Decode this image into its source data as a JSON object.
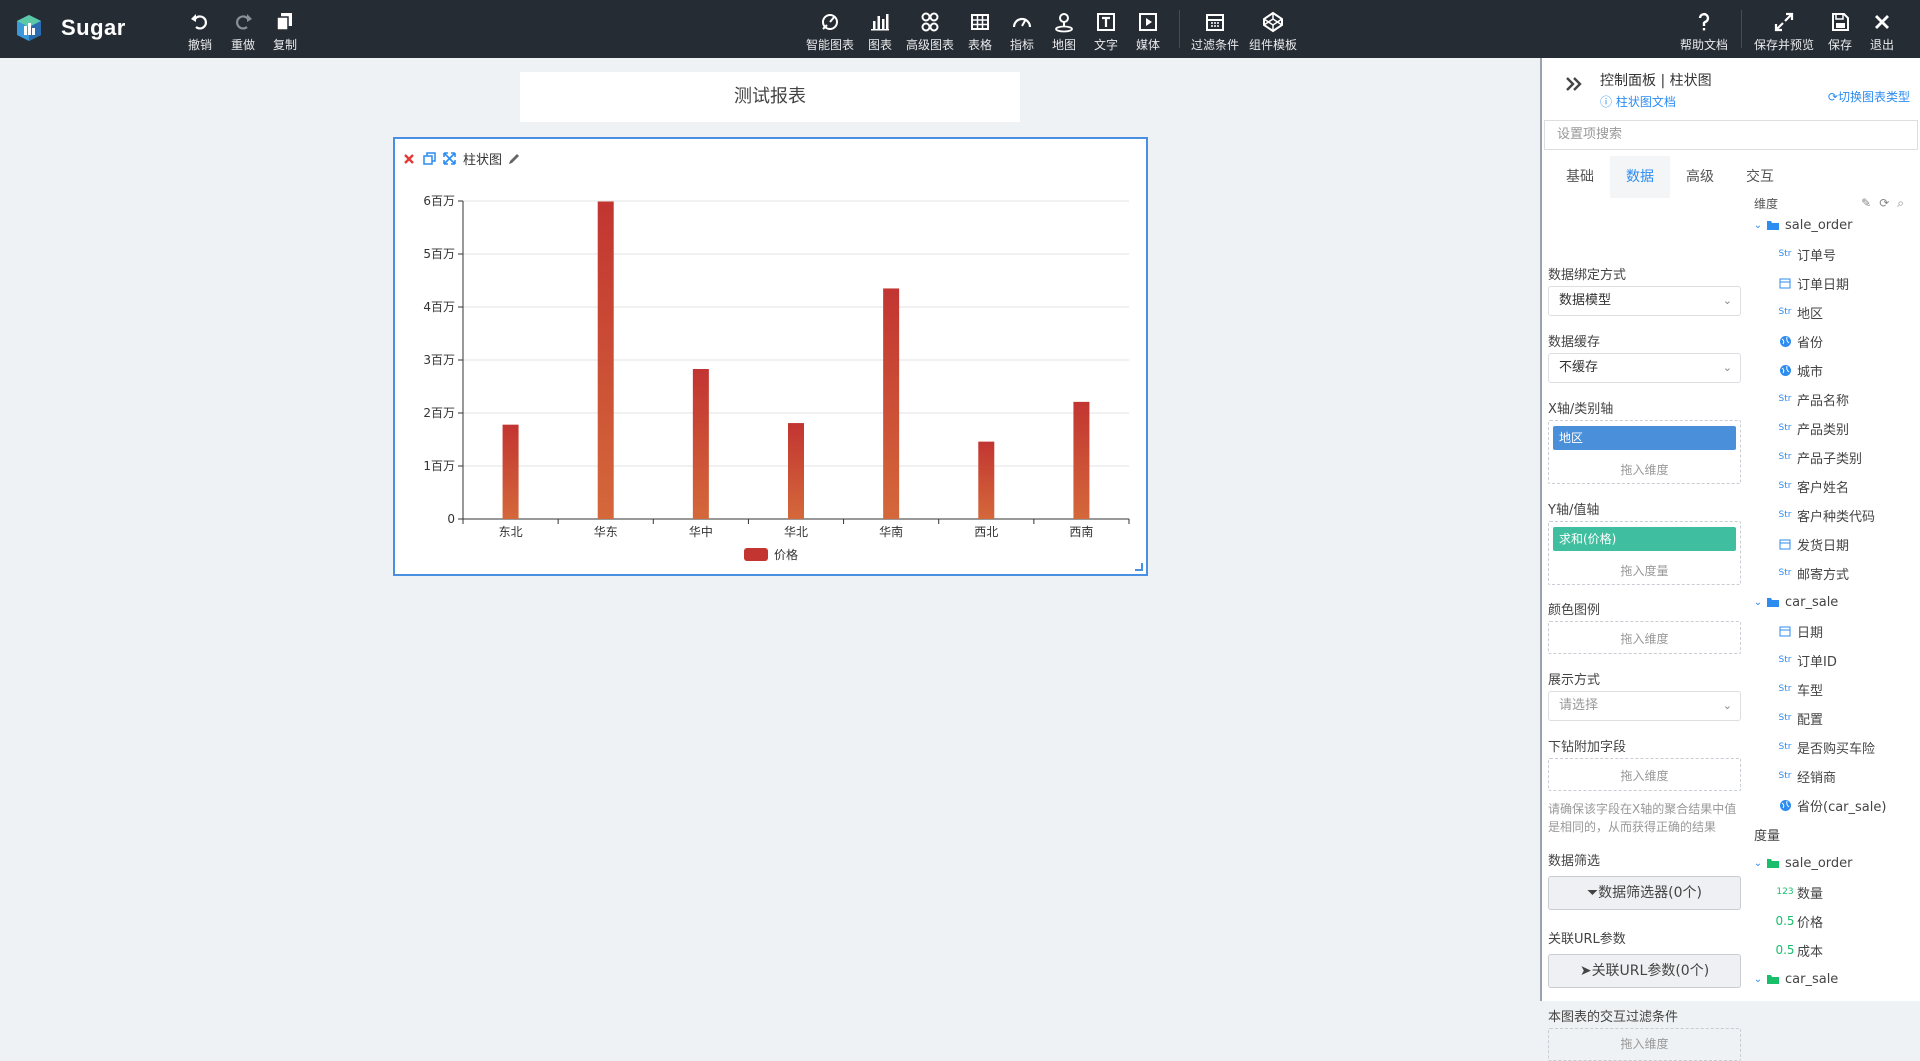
{
  "app": {
    "name": "Sugar"
  },
  "toolbar": {
    "undo": "撤销",
    "redo": "重做",
    "copy": "复制",
    "smart_chart": "智能图表",
    "chart": "图表",
    "advanced_chart": "高级图表",
    "table": "表格",
    "indicator": "指标",
    "map": "地图",
    "text": "文字",
    "media": "媒体",
    "filter": "过滤条件",
    "template": "组件模板",
    "help": "帮助文档",
    "save_preview": "保存并预览",
    "save": "保存",
    "exit": "退出"
  },
  "report": {
    "title": "测试报表"
  },
  "widget": {
    "title": "柱状图"
  },
  "chart_data": {
    "type": "bar",
    "categories": [
      "东北",
      "华东",
      "华中",
      "华北",
      "华南",
      "西北",
      "西南"
    ],
    "series": [
      {
        "name": "价格",
        "values": [
          1780000,
          5990000,
          2830000,
          1810000,
          4350000,
          1460000,
          2210000
        ]
      }
    ],
    "ylim": [
      0,
      6000000
    ],
    "yticks": [
      0,
      1000000,
      2000000,
      3000000,
      4000000,
      5000000,
      6000000
    ],
    "ytick_labels": [
      "0",
      "1百万",
      "2百万",
      "3百万",
      "4百万",
      "5百万",
      "6百万"
    ],
    "grid": true,
    "legend": "bottom-center",
    "colors": {
      "bar_top": "#c23531",
      "bar_bottom": "#d4683a"
    }
  },
  "panel": {
    "title": "控制面板 | 柱状图",
    "doc_link": "柱状图文档",
    "switch_type": "切换图表类型",
    "search_placeholder": "设置项搜索",
    "tabs": [
      "基础",
      "数据",
      "高级",
      "交互"
    ],
    "config": {
      "binding_label": "数据绑定方式",
      "binding_value": "数据模型",
      "cache_label": "数据缓存",
      "cache_value": "不缓存",
      "x_label": "X轴/类别轴",
      "x_chip": "地区",
      "x_hint": "拖入维度",
      "y_label": "Y轴/值轴",
      "y_chip": "求和(价格)",
      "y_hint": "拖入度量",
      "legend_label": "颜色图例",
      "legend_hint": "拖入维度",
      "display_label": "展示方式",
      "display_placeholder": "请选择",
      "drill_label": "下钻附加字段",
      "drill_hint": "拖入维度",
      "drill_note": "请确保该字段在X轴的聚合结果中值是相同的，从而获得正确的结果",
      "filter_label": "数据筛选",
      "filter_button": "数据筛选器(0个)",
      "url_label": "关联URL参数",
      "url_button": "关联URL参数(0个)",
      "interact_label": "本图表的交互过滤条件",
      "interact_hint": "拖入维度"
    },
    "tree": {
      "dimension_header": "维度",
      "measure_header": "度量",
      "dim_groups": [
        {
          "name": "sale_order",
          "fields": [
            {
              "icon": "Str",
              "label": "订单号"
            },
            {
              "icon": "date",
              "label": "订单日期"
            },
            {
              "icon": "Str",
              "label": "地区"
            },
            {
              "icon": "geo",
              "label": "省份"
            },
            {
              "icon": "geo",
              "label": "城市"
            },
            {
              "icon": "Str",
              "label": "产品名称"
            },
            {
              "icon": "Str",
              "label": "产品类别"
            },
            {
              "icon": "Str",
              "label": "产品子类别"
            },
            {
              "icon": "Str",
              "label": "客户姓名"
            },
            {
              "icon": "Str",
              "label": "客户种类代码"
            },
            {
              "icon": "date",
              "label": "发货日期"
            },
            {
              "icon": "Str",
              "label": "邮寄方式"
            }
          ]
        },
        {
          "name": "car_sale",
          "fields": [
            {
              "icon": "date",
              "label": "日期"
            },
            {
              "icon": "Str",
              "label": "订单ID"
            },
            {
              "icon": "Str",
              "label": "车型"
            },
            {
              "icon": "Str",
              "label": "配置"
            },
            {
              "icon": "Str",
              "label": "是否购买车险"
            },
            {
              "icon": "Str",
              "label": "经销商"
            },
            {
              "icon": "geo",
              "label": "省份(car_sale)"
            }
          ]
        }
      ],
      "measure_groups": [
        {
          "name": "sale_order",
          "fields": [
            {
              "icon": "123",
              "label": "数量"
            },
            {
              "icon": "0.5",
              "label": "价格"
            },
            {
              "icon": "0.5",
              "label": "成本"
            }
          ]
        },
        {
          "name": "car_sale",
          "fields": []
        }
      ]
    }
  }
}
